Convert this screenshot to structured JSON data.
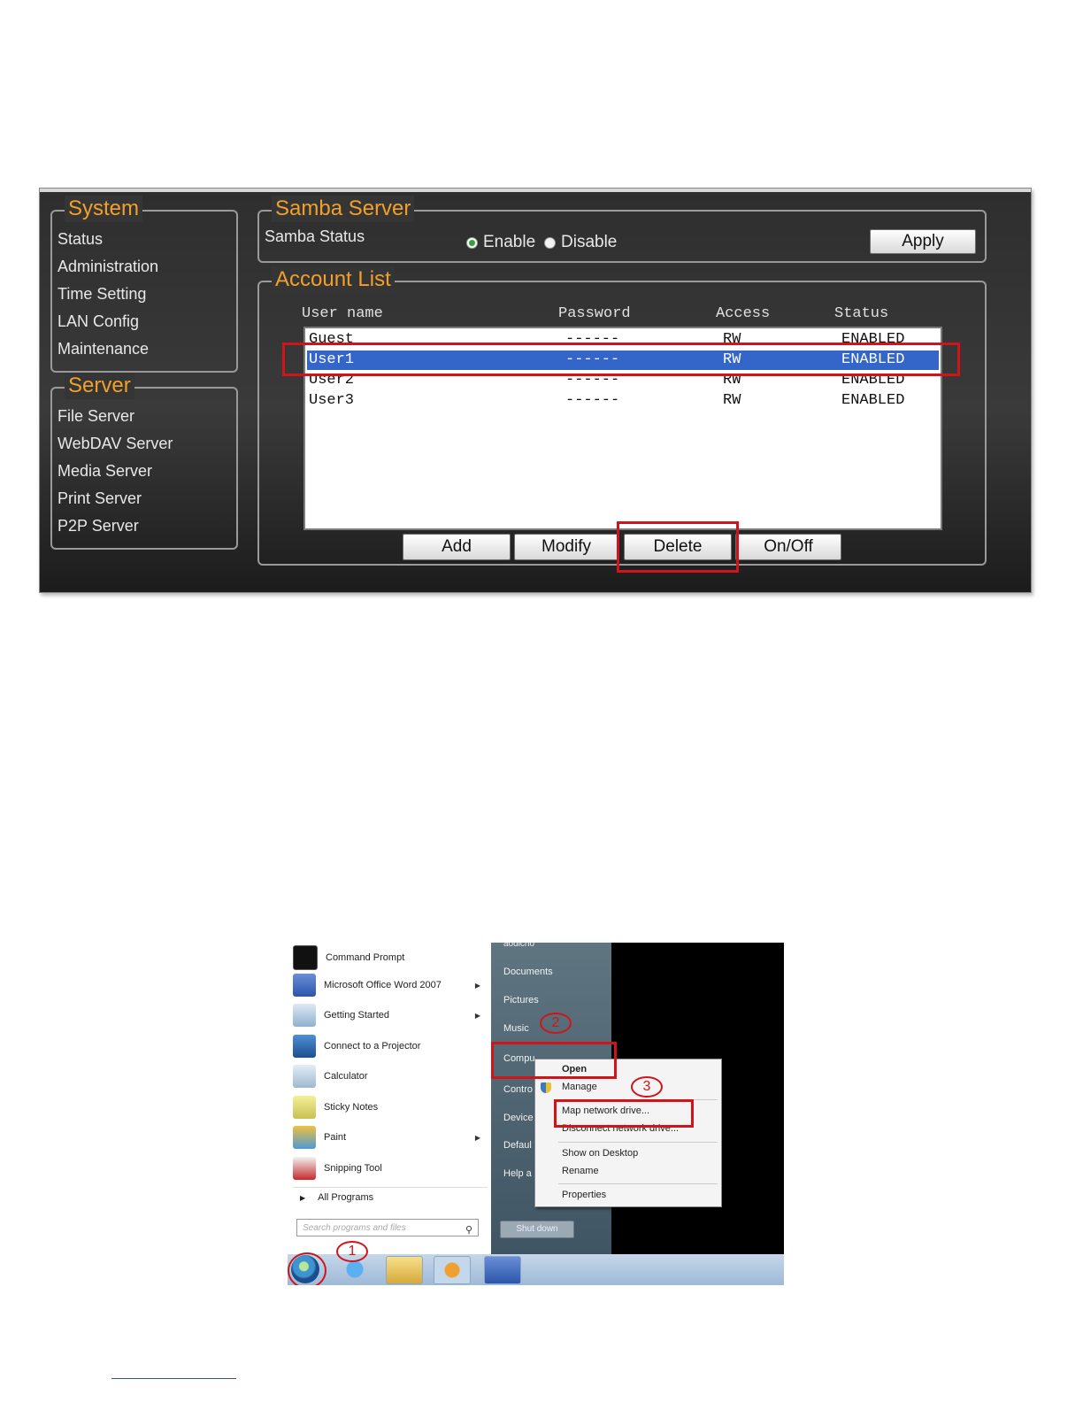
{
  "system": {
    "legend": "System",
    "items": [
      "Status",
      "Administration",
      "Time Setting",
      "LAN Config",
      "Maintenance"
    ]
  },
  "server": {
    "legend": "Server",
    "items": [
      "File Server",
      "WebDAV Server",
      "Media Server",
      "Print Server",
      "P2P Server"
    ]
  },
  "samba": {
    "legend": "Samba Server",
    "status_label": "Samba Status",
    "enable_label": "Enable",
    "disable_label": "Disable",
    "selected": "Enable",
    "apply_label": "Apply"
  },
  "accounts": {
    "legend": "Account List",
    "columns": [
      "User name",
      "Password",
      "Access",
      "Status"
    ],
    "rows": [
      {
        "user": "Guest",
        "password": "------",
        "access": "RW",
        "status": "ENABLED"
      },
      {
        "user": "User1",
        "password": "------",
        "access": "RW",
        "status": "ENABLED"
      },
      {
        "user": "User2",
        "password": "------",
        "access": "RW",
        "status": "ENABLED"
      },
      {
        "user": "User3",
        "password": "------",
        "access": "RW",
        "status": "ENABLED"
      }
    ],
    "selected_row": "User1",
    "buttons": {
      "add": "Add",
      "modify": "Modify",
      "delete": "Delete",
      "onoff": "On/Off"
    }
  },
  "start_menu": {
    "programs": [
      {
        "label": "Command Prompt",
        "icon": "command-prompt-icon",
        "submenu": false
      },
      {
        "label": "Microsoft Office Word 2007",
        "icon": "word-icon",
        "submenu": true
      },
      {
        "label": "Getting Started",
        "icon": "getting-started-icon",
        "submenu": true
      },
      {
        "label": "Connect to a Projector",
        "icon": "projector-icon",
        "submenu": false
      },
      {
        "label": "Calculator",
        "icon": "calculator-icon",
        "submenu": false
      },
      {
        "label": "Sticky Notes",
        "icon": "sticky-notes-icon",
        "submenu": false
      },
      {
        "label": "Paint",
        "icon": "paint-icon",
        "submenu": true
      },
      {
        "label": "Snipping Tool",
        "icon": "snipping-tool-icon",
        "submenu": false
      }
    ],
    "all_programs": "All Programs",
    "search_placeholder": "Search programs and files",
    "right_items": [
      "aodicho",
      "Documents",
      "Pictures",
      "Music",
      "Compu",
      "Contro",
      "Device",
      "Defaul",
      "Help a"
    ],
    "shutdown_label": "Shut down",
    "context_menu": [
      "Open",
      "Manage",
      "Map network drive...",
      "Disconnect network drive...",
      "Show on Desktop",
      "Rename",
      "Properties"
    ],
    "callouts": [
      "1",
      "2",
      "3"
    ]
  },
  "colors": {
    "accent": "#f2a02a",
    "highlight": "#d0141a",
    "selection": "#3465c8"
  }
}
